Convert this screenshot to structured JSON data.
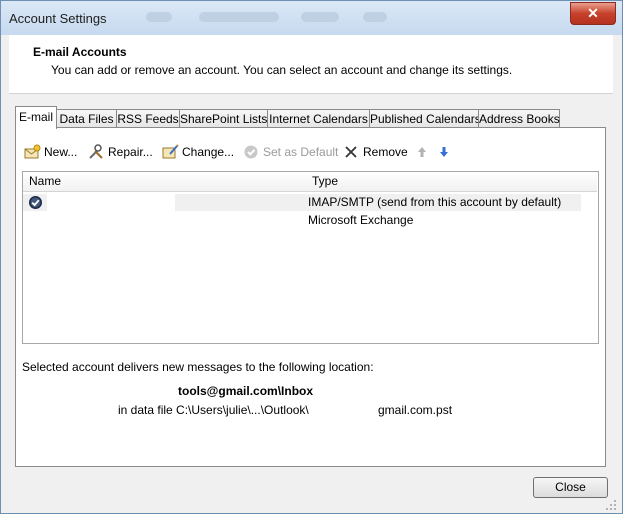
{
  "window": {
    "title": "Account Settings"
  },
  "header": {
    "title": "E-mail Accounts",
    "description": "You can add or remove an account. You can select an account and change its settings."
  },
  "tabs": [
    {
      "label": "E-mail",
      "active": true
    },
    {
      "label": "Data Files"
    },
    {
      "label": "RSS Feeds"
    },
    {
      "label": "SharePoint Lists"
    },
    {
      "label": "Internet Calendars"
    },
    {
      "label": "Published Calendars"
    },
    {
      "label": "Address Books"
    }
  ],
  "toolbar": {
    "new_label": "New...",
    "repair_label": "Repair...",
    "change_label": "Change...",
    "set_default_label": "Set as Default",
    "remove_label": "Remove"
  },
  "accounts": {
    "columns": {
      "name": "Name",
      "type": "Type"
    },
    "rows": [
      {
        "type": "IMAP/SMTP (send from this account by default)",
        "is_default": true
      },
      {
        "type": "Microsoft Exchange"
      }
    ]
  },
  "delivery": {
    "intro": "Selected account delivers new messages to the following location:",
    "location": "tools@gmail.com\\Inbox",
    "data_file_prefix": "in data file C:\\Users\\julie\\...\\Outlook\\",
    "data_file_suffix": "gmail.com.pst"
  },
  "footer": {
    "close_label": "Close"
  },
  "icons": {
    "new": "new-account-icon",
    "repair": "repair-icon",
    "change": "change-icon",
    "set_default": "check-circle-icon",
    "remove": "x-icon",
    "move_up": "arrow-up-icon",
    "move_down": "arrow-down-icon",
    "default_account": "default-check-icon"
  },
  "colors": {
    "accent_blue": "#3a6fd8",
    "title_gradient_top": "#dbe8f6",
    "close_red": "#c7412b"
  }
}
